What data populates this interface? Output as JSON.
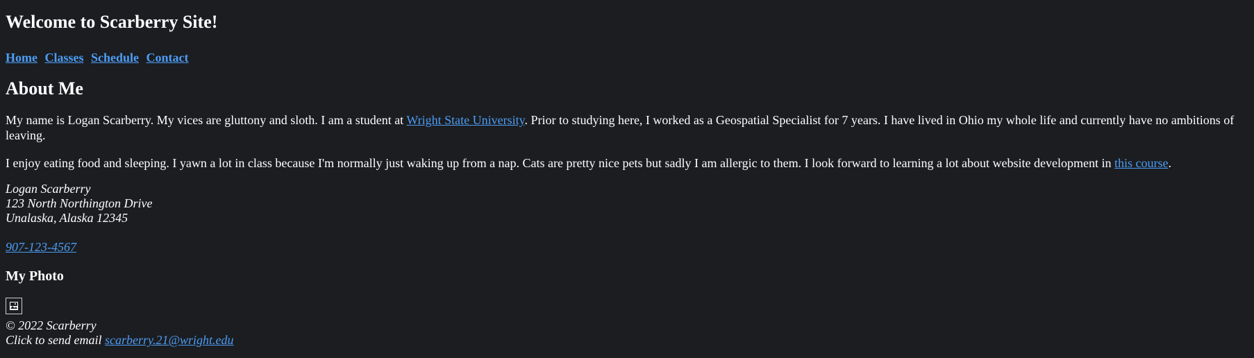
{
  "site_title": "Welcome to Scarberry Site!",
  "nav": {
    "items": [
      {
        "label": "Home"
      },
      {
        "label": "Classes"
      },
      {
        "label": "Schedule"
      },
      {
        "label": "Contact"
      }
    ]
  },
  "about": {
    "heading": "About Me",
    "para1_before": "My name is Logan Scarberry. My vices are gluttony and sloth. I am a student at ",
    "para1_link": "Wright State University",
    "para1_after": ". Prior to studying here, I worked as a Geospatial Specialist for 7 years. I have lived in Ohio my whole life and currently have no ambitions of leaving.",
    "para2_before": "I enjoy eating food and sleeping. I yawn a lot in class because I'm normally just waking up from a nap. Cats are pretty nice pets but sadly I am allergic to them. I look forward to learning a lot about website development in ",
    "para2_link": "this course",
    "para2_after": "."
  },
  "address": {
    "name": "Logan Scarberry",
    "street": "123 North Northington Drive",
    "city": "Unalaska, Alaska 12345",
    "phone": "907-123-4567"
  },
  "photo": {
    "heading": "My Photo",
    "icon": "broken-image-icon"
  },
  "footer": {
    "copyright": "© 2022 Scarberry",
    "email_prefix": "Click to send email ",
    "email": "scarberry.21@wright.edu"
  },
  "colors": {
    "background": "#1b1d21",
    "text": "#ffffff",
    "link": "#4d9df4"
  }
}
